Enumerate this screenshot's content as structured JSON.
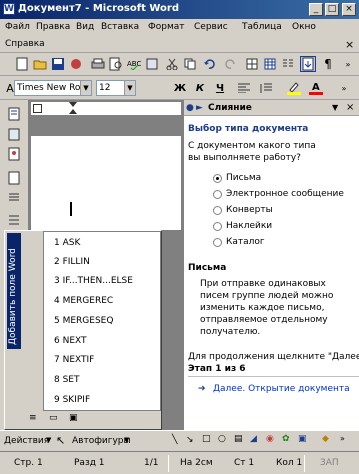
{
  "window": {
    "title": "Документ7 - Microsoft Word",
    "min": "_",
    "max": "□",
    "close": "×"
  },
  "menu": {
    "items": [
      "Файл",
      "Правка",
      "Вид",
      "Вставка",
      "Формат",
      "Сервис",
      "Таблица",
      "Окно"
    ],
    "second_row": "Справка",
    "close": "×"
  },
  "toolbar": {
    "style": "Times New Roman",
    "size": "12",
    "bold": "Ж",
    "italic": "К",
    "underline": "Ч"
  },
  "task_pane": {
    "title": "Слияние",
    "section1_title": "Выбор типа документа",
    "prompt": "С документом какого типа вы выполняете работу?",
    "options": [
      "Письма",
      "Электронное сообщение",
      "Конверты",
      "Наклейки",
      "Каталог"
    ],
    "selected": 0,
    "section2_title": "Письма",
    "description": "При отправке одинаковых писем группе людей можно изменить каждое письмо, отправляемое отдельному получателю.",
    "continue_text": "Для продолжения щелкните \"Далее\".",
    "step": "Этап 1 из 6",
    "next_link": "Далее. Открытие документа"
  },
  "mail_merge_toolbar": {
    "title": "Добавить поле Word",
    "items": [
      "1 ASK",
      "2 FILLIN",
      "3 IF...THEN...ELSE",
      "4 MERGEREC",
      "5 MERGESEQ",
      "6 NEXT",
      "7 NEXTIF",
      "8 SET",
      "9 SKIPIF"
    ]
  },
  "drawing_bar": {
    "actions": "Действия",
    "autoshapes": "Автофигуры"
  },
  "status": {
    "page": "Стр. 1",
    "section": "Разд 1",
    "pages": "1/1",
    "at": "На 2см",
    "line": "Ст 1",
    "col": "Кол 1",
    "rec": "ЗАП"
  }
}
